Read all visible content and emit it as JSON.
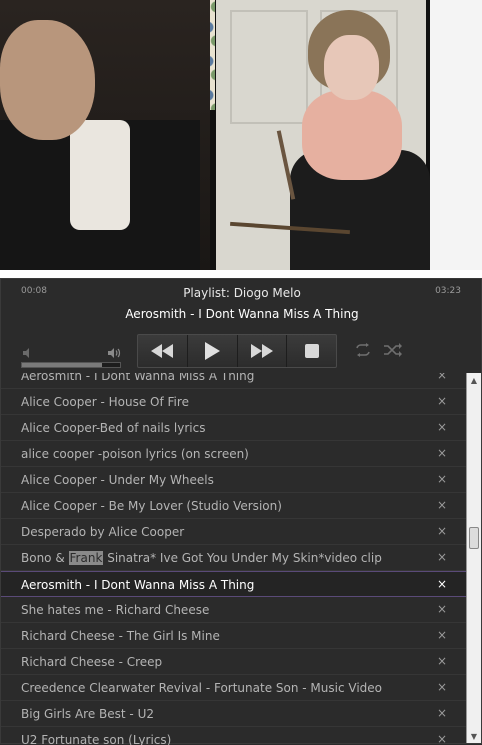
{
  "player": {
    "elapsed": "00:08",
    "duration": "03:23",
    "playlist_title": "Playlist: Diogo Melo",
    "now_playing": "Aerosmith - I Dont Wanna Miss A Thing",
    "volume_level": 0.82,
    "icons": {
      "volume_low": "volume-low-icon",
      "volume_high": "volume-high-icon",
      "rewind": "rewind-icon",
      "play": "play-icon",
      "fast_forward": "fast-forward-icon",
      "stop": "stop-icon",
      "repeat": "repeat-icon",
      "shuffle": "shuffle-icon"
    }
  },
  "playlist": {
    "remove_label": "×",
    "partial_top": "Aerosmith - I Dont Wanna Miss A Thing",
    "items": [
      {
        "title": "Alice Cooper - House Of Fire"
      },
      {
        "title": "Alice Cooper-Bed of nails lyrics"
      },
      {
        "title": "alice cooper -poison lyrics (on screen)"
      },
      {
        "title": "Alice Cooper - Under My Wheels"
      },
      {
        "title": "Alice Cooper - Be My Lover (Studio Version)"
      },
      {
        "title": "Desperado by Alice Cooper"
      },
      {
        "title_pre": "Bono & ",
        "title_hl": "Frank",
        "title_post": " Sinatra* Ive Got You Under My Skin*video clip"
      },
      {
        "title": "Aerosmith - I Dont Wanna Miss A Thing",
        "active": true
      },
      {
        "title": "She hates me - Richard Cheese"
      },
      {
        "title": "Richard Cheese - The Girl Is Mine"
      },
      {
        "title": "Richard Cheese - Creep"
      },
      {
        "title": "Creedence Clearwater Revival - Fortunate Son - Music Video"
      },
      {
        "title": "Big Girls Are Best - U2"
      }
    ],
    "partial_bottom": "U2 Fortunate son (Lyrics)"
  },
  "colors": {
    "background": "#2b2b2b",
    "active_border": "#5a4a78",
    "text": "#b4b4b4"
  }
}
